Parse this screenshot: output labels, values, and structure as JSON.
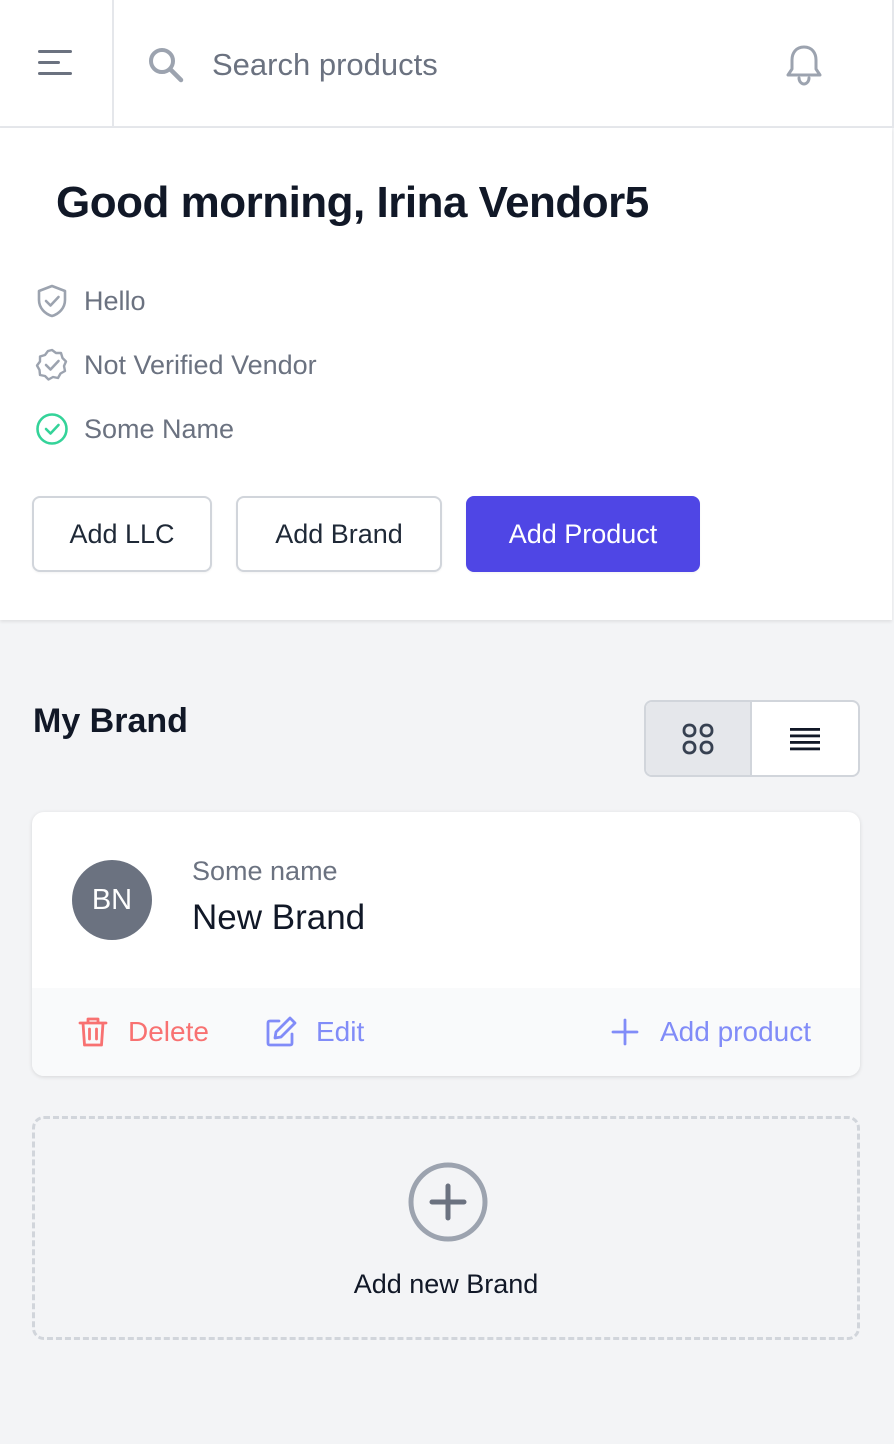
{
  "topbar": {
    "search_placeholder": "Search products"
  },
  "greeting": "Good morning, Irina Vendor5",
  "statuses": [
    {
      "label": "Hello",
      "icon": "shield-check-icon",
      "color": "#9ca3af"
    },
    {
      "label": "Not Verified Vendor",
      "icon": "badge-check-icon",
      "color": "#9ca3af"
    },
    {
      "label": "Some Name",
      "icon": "check-circle-icon",
      "color": "#34d399"
    }
  ],
  "actions": {
    "add_llc": "Add LLC",
    "add_brand": "Add Brand",
    "add_product": "Add Product"
  },
  "brands_section": {
    "title": "My Brand",
    "view_modes": [
      "grid",
      "list"
    ],
    "active_view": "grid"
  },
  "brand": {
    "initials": "BN",
    "subtitle": "Some name",
    "name": "New Brand",
    "delete_label": "Delete",
    "edit_label": "Edit",
    "add_product_label": "Add product"
  },
  "add_new_brand_label": "Add new Brand",
  "colors": {
    "primary": "#4f46e5",
    "danger": "#f87171",
    "link": "#6366f1",
    "success": "#34d399"
  }
}
